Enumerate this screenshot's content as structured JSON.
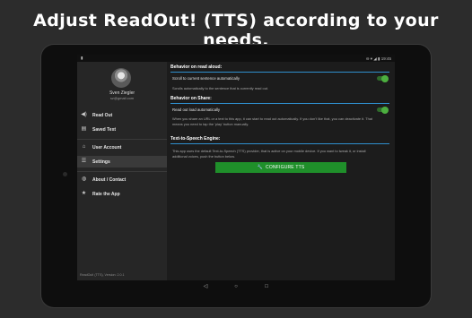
{
  "headline": "Adjust ReadOut! (TTS) according to your needs.",
  "status_bar": {
    "left_icon": "notification-icon",
    "time": "19:45",
    "right_icons": "⊖ ▾ ◢ ▮"
  },
  "drawer": {
    "user_name": "Sven Ziegler",
    "user_email": "sz@gmail.com",
    "items": [
      {
        "label": "Read Out",
        "icon": "volume-icon",
        "glyph": "◀)"
      },
      {
        "label": "Saved Text",
        "icon": "document-icon",
        "glyph": "▤"
      },
      {
        "label": "User Account",
        "icon": "lock-icon",
        "glyph": "🔒"
      },
      {
        "label": "Settings",
        "icon": "sliders-icon",
        "glyph": "☰",
        "active": true
      },
      {
        "label": "About / Contact",
        "icon": "globe-icon",
        "glyph": "◍"
      },
      {
        "label": "Rate the App",
        "icon": "star-icon",
        "glyph": "★"
      }
    ],
    "version": "ReadOut! (TTS), Version: 2.0.1"
  },
  "settings": {
    "read_aloud": {
      "header": "Behavior on read aloud:",
      "option": "Scroll to current sentence automatically",
      "description": "Scrolls automatically to the sentence that is currently read out.",
      "enabled": true
    },
    "share": {
      "header": "Behavior on Share:",
      "option": "Read out load automatically",
      "description": "When you share an URL or a text to this app, it can start to read out automatically. If you don't like that, you can deactivate it. That means you need to tap the 'play' button manually.",
      "enabled": true
    },
    "engine": {
      "header": "Text-to-Speech Engine:",
      "description": "This app uses the default Text-to-Speech (TTS) provider, that is active on your mobile device. If you want to tweak it, or install additional voices, push the button below.",
      "button_label": "CONFIGURE TTS",
      "button_icon": "wrench-icon"
    }
  },
  "nav_buttons": {
    "back": "◁",
    "home": "○",
    "recents": "□"
  },
  "colors": {
    "accent_line": "#2f8fce",
    "button": "#1f8f2a",
    "toggle": "#4caf3f"
  }
}
